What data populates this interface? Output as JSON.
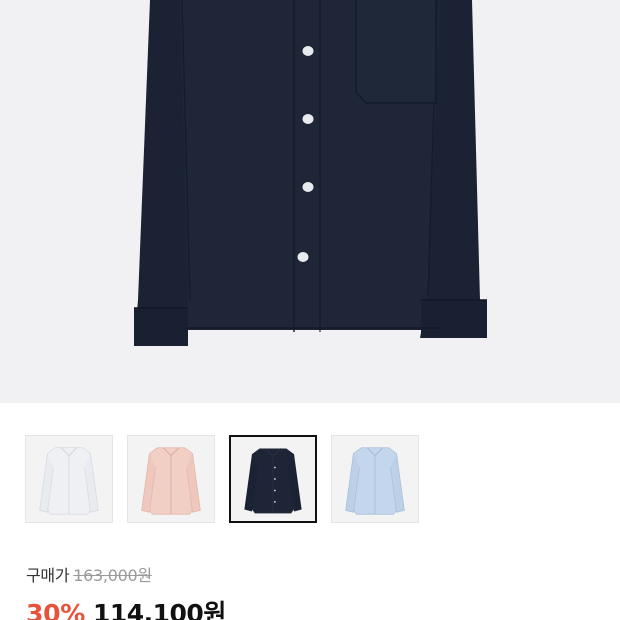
{
  "product": {
    "image_alt": "navy shirt",
    "thumbnails": [
      {
        "color_name": "white",
        "color": "#eef0f4",
        "selected": false
      },
      {
        "color_name": "pink",
        "color": "#f2cfc5",
        "selected": false
      },
      {
        "color_name": "navy",
        "color": "#1d2536",
        "selected": true
      },
      {
        "color_name": "light-blue",
        "color": "#c3d6ec",
        "selected": false
      }
    ]
  },
  "price": {
    "buy_label": "구매가",
    "original_price": "163,000원",
    "discount_rate": "30%",
    "sale_price": "114,100원"
  },
  "colors": {
    "accent_discount": "#e8513a",
    "shirt_main": "#1d2536",
    "hero_background": "#f1f1f3"
  }
}
